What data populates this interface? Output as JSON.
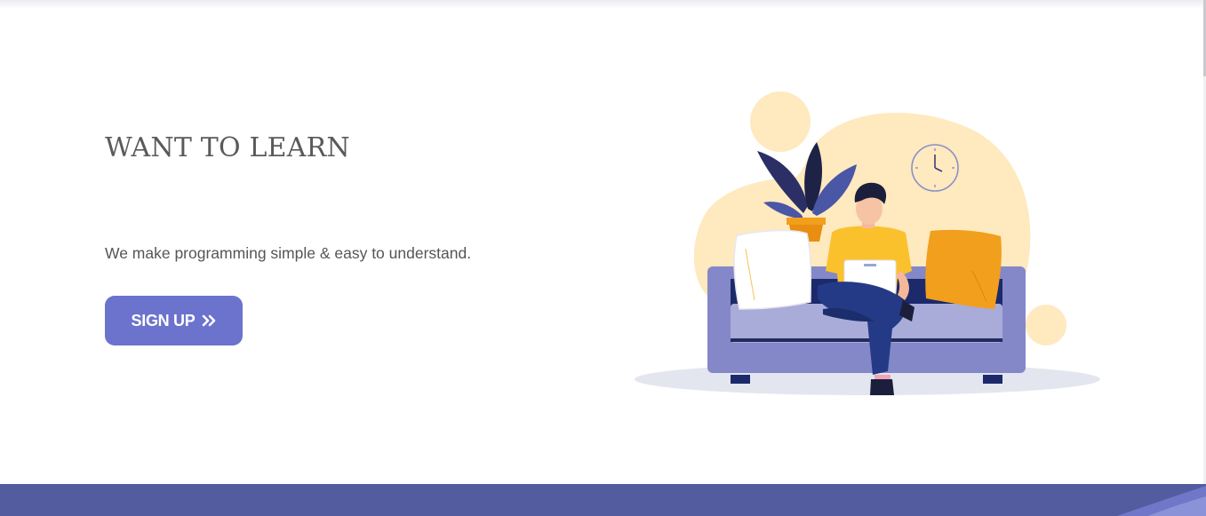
{
  "hero": {
    "title": "WANT TO LEARN",
    "subtitle": "We make programming simple & easy to understand.",
    "cta": {
      "label": "SIGN UP",
      "icon": "double-chevron-right-icon"
    }
  },
  "illustration": {
    "subject": "person-with-laptop-on-sofa",
    "icons": [
      "plant-icon",
      "clock-icon",
      "laptop-icon"
    ]
  },
  "colors": {
    "accent": "#6c73cd",
    "footer": "#525c9e",
    "title_text": "#5a5a5a",
    "body_text": "#555555",
    "sofa": "#8488c8",
    "blob": "#ffe9bf",
    "shirt": "#fbc12d",
    "cushion_orange": "#f19f1d"
  }
}
